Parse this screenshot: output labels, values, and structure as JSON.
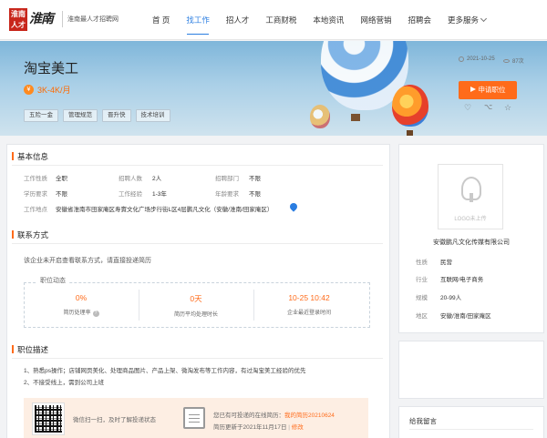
{
  "header": {
    "logo_seal": "淮南 人才",
    "logo_script": "淮南",
    "logo_sub": "淮南最人才招聘网",
    "nav": [
      {
        "label": "首 页",
        "active": false
      },
      {
        "label": "找工作",
        "active": true
      },
      {
        "label": "招人才",
        "active": false
      },
      {
        "label": "工商财税",
        "active": false
      },
      {
        "label": "本地资讯",
        "active": false
      },
      {
        "label": "网络营销",
        "active": false
      },
      {
        "label": "招聘会",
        "active": false
      },
      {
        "label": "更多服务",
        "active": false
      }
    ]
  },
  "job": {
    "title": "淘宝美工",
    "salary_icon": "¥",
    "salary": "3K-4K/月",
    "tags": [
      "五险一金",
      "管理规范",
      "晋升快",
      "技术培训"
    ],
    "date": "2021-10-25",
    "views": "87次",
    "apply_label": "申请职位"
  },
  "basic": {
    "title": "基本信息",
    "rows": [
      [
        {
          "label": "工作性质",
          "value": "全职"
        },
        {
          "label": "招聘人数",
          "value": "2人"
        },
        {
          "label": "招聘部门",
          "value": "不限"
        }
      ],
      [
        {
          "label": "学历要求",
          "value": "不限"
        },
        {
          "label": "工作经验",
          "value": "1-3年"
        },
        {
          "label": "年龄要求",
          "value": "不限"
        }
      ]
    ],
    "address_label": "工作地点",
    "address": "安徽省淮南市田家庵区寿賨文化广场步行街L区4层鹏凡文化（安徽/淮南/田家庵区）"
  },
  "contact": {
    "title": "联系方式",
    "text": "该企业未开启查看联系方式，请直接投递简历",
    "dynamics_label": "职位动态",
    "stats": [
      {
        "value": "0%",
        "caption": "简历处理率"
      },
      {
        "value": "0天",
        "caption": "简历平均处理时长"
      },
      {
        "value": "10-25 10:42",
        "caption": "企业最近登录时间"
      }
    ],
    "help_icon": "?"
  },
  "description": {
    "title": "职位描述",
    "lines": [
      "1、熟悉ps操作；店铺网页美化、处理商品图片、产品上架、微淘发布等工作内容，有过淘宝美工经验的优先",
      "2、不接受线上，需到公司上班"
    ]
  },
  "promo": {
    "wechat_text": "微信扫一扫，及时了解投递状态",
    "resume_prefix": "您已有可投递的在线简历：",
    "resume_link": "我的简历20210624",
    "updated": "简历更新于2021年11月17日",
    "sep": "|",
    "edit": "修改"
  },
  "company": {
    "logo_text": "LOGO未上传",
    "name": "安徽鹏凡文化传媒有限公司",
    "rows": [
      {
        "label": "性质",
        "value": "民营"
      },
      {
        "label": "行业",
        "value": "互联网/电子商务"
      },
      {
        "label": "规模",
        "value": "20-99人"
      },
      {
        "label": "地区",
        "value": "安徽/淮南/田家庵区"
      }
    ]
  },
  "message": {
    "title": "给我留言"
  }
}
